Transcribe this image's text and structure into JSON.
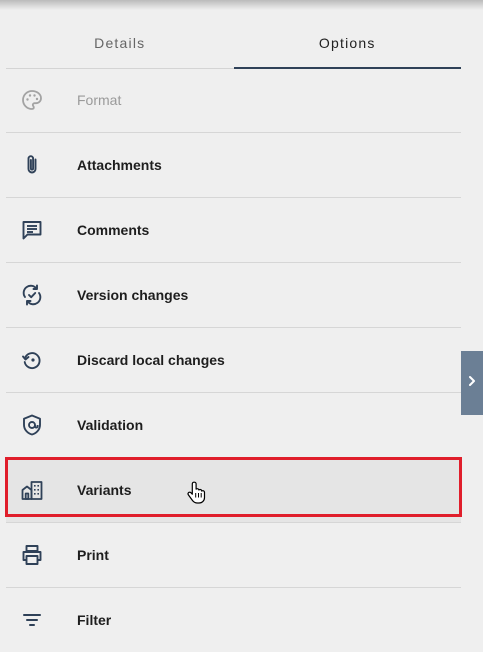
{
  "tabs": [
    {
      "label": "Details",
      "active": false
    },
    {
      "label": "Options",
      "active": true
    }
  ],
  "menu": {
    "items": [
      {
        "label": "Format",
        "icon": "palette-icon",
        "disabled": true
      },
      {
        "label": "Attachments",
        "icon": "paperclip-icon"
      },
      {
        "label": "Comments",
        "icon": "comment-icon"
      },
      {
        "label": "Version changes",
        "icon": "sync-check-icon"
      },
      {
        "label": "Discard local changes",
        "icon": "restore-icon"
      },
      {
        "label": "Validation",
        "icon": "shield-icon"
      },
      {
        "label": "Variants",
        "icon": "buildings-icon",
        "hovered": true
      },
      {
        "label": "Print",
        "icon": "printer-icon"
      },
      {
        "label": "Filter",
        "icon": "filter-icon"
      }
    ]
  },
  "colors": {
    "accent": "#2f4158",
    "highlight": "#e01e2b",
    "side_toggle": "#6b7f95",
    "background": "#efefef"
  },
  "side_toggle": {
    "icon": "chevron-right-icon"
  }
}
